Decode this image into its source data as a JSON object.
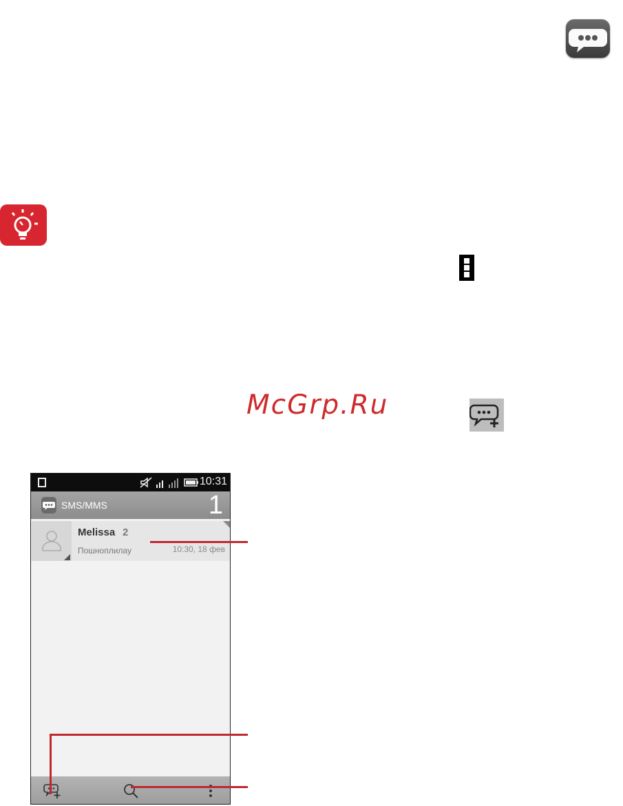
{
  "watermark": "McGrp.Ru",
  "icons": {
    "app": "messaging-app-icon",
    "tip": "lightbulb-tip-icon",
    "menu": "overflow-menu-icon",
    "new_message": "new-message-icon"
  },
  "colors": {
    "accent_red": "#c0272d",
    "tip_red": "#d7262f"
  },
  "phone": {
    "status_bar": {
      "time": "10:31"
    },
    "action_bar": {
      "title": "SMS/MMS",
      "unread_count": "1"
    },
    "conversation": {
      "name": "Melissa",
      "count": "2",
      "preview": "Пошноплилау",
      "time": "10:30, 18 фев"
    }
  }
}
